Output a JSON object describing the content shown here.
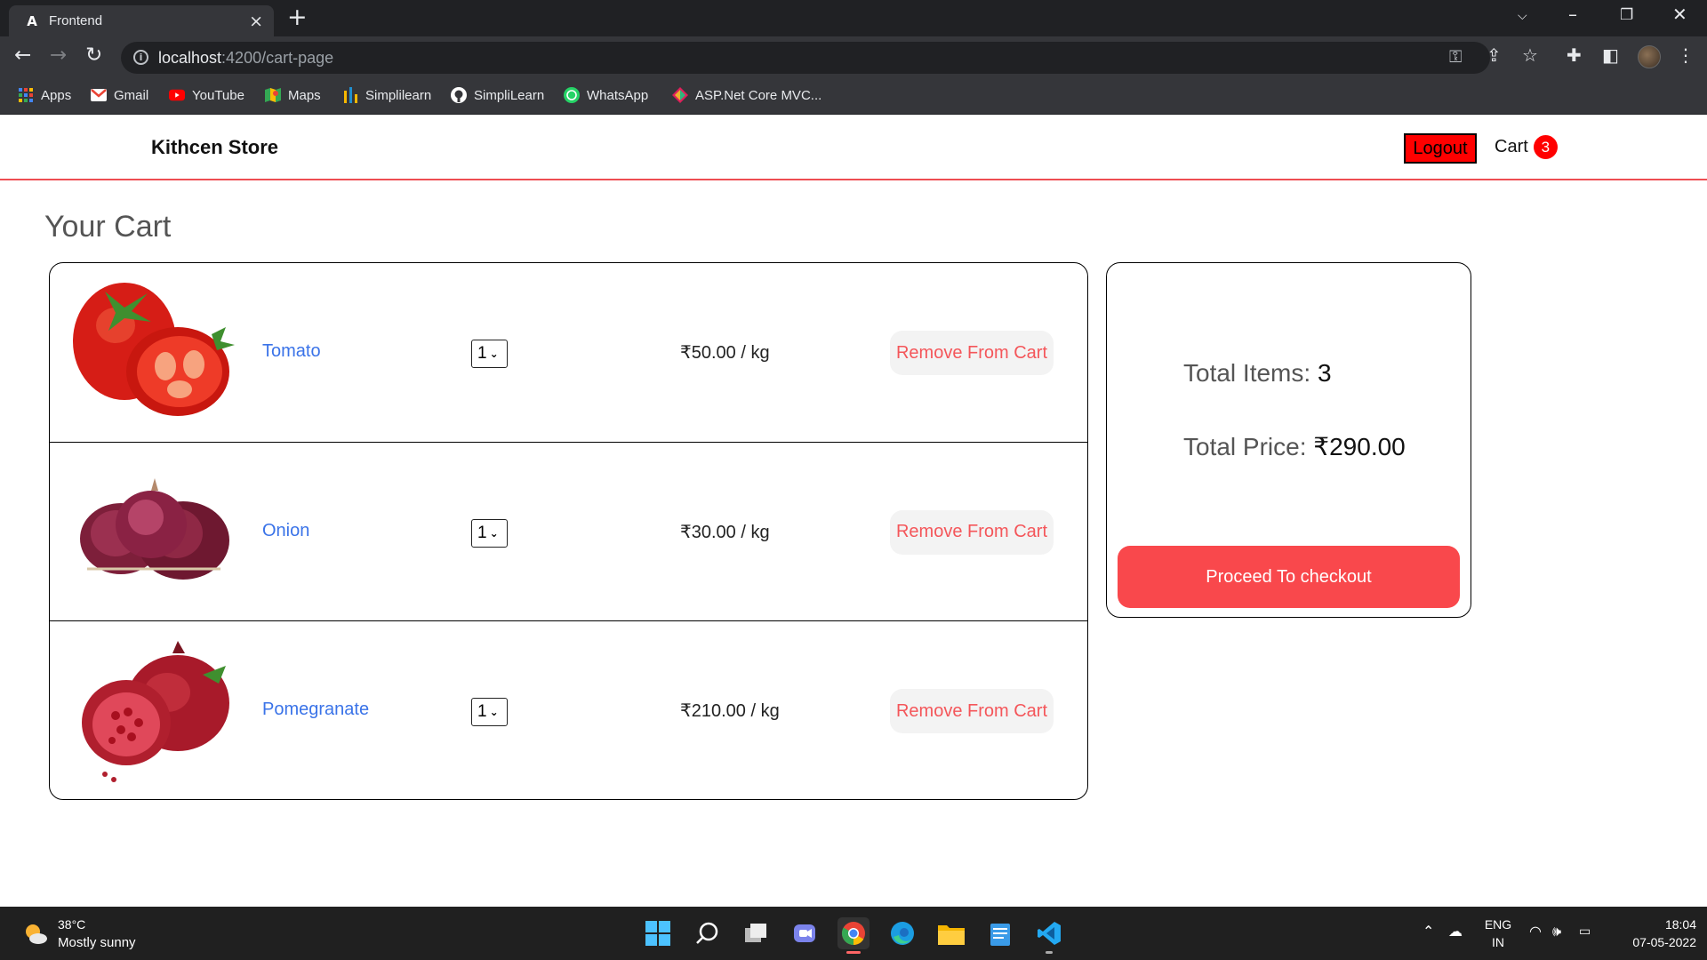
{
  "browser": {
    "tab_title": "Frontend",
    "url_host": "localhost",
    "url_path": ":4200/cart-page",
    "bookmarks": [
      {
        "label": "Apps",
        "icon": "apps-grid-icon"
      },
      {
        "label": "Gmail",
        "icon": "gmail-icon"
      },
      {
        "label": "YouTube",
        "icon": "youtube-icon"
      },
      {
        "label": "Maps",
        "icon": "maps-icon"
      },
      {
        "label": "Simplilearn",
        "icon": "simplilearn-icon"
      },
      {
        "label": "SimpliLearn",
        "icon": "github-icon"
      },
      {
        "label": "WhatsApp",
        "icon": "whatsapp-icon"
      },
      {
        "label": "ASP.Net Core MVC...",
        "icon": "aspnet-icon"
      }
    ]
  },
  "navbar": {
    "brand": "Kithcen Store",
    "logout_label": "Logout",
    "cart_label": "Cart",
    "cart_count": "3",
    "accent_color": "#ee4e52"
  },
  "page": {
    "title": "Your Cart"
  },
  "cart": {
    "items": [
      {
        "name": "Tomato",
        "quantity": "1",
        "price": "₹50.00 / kg",
        "remove_label": "Remove From Cart",
        "image": "tomato-image"
      },
      {
        "name": "Onion",
        "quantity": "1",
        "price": "₹30.00 / kg",
        "remove_label": "Remove From Cart",
        "image": "onion-image"
      },
      {
        "name": "Pomegranate",
        "quantity": "1",
        "price": "₹210.00 / kg",
        "remove_label": "Remove From Cart",
        "image": "pomegranate-image"
      }
    ]
  },
  "summary": {
    "total_items_label": "Total Items:",
    "total_items_value": "3",
    "total_price_label": "Total Price:",
    "total_price_value": "₹290.00",
    "checkout_label": "Proceed To checkout",
    "checkout_color": "#f9484c"
  },
  "taskbar": {
    "weather_temp": "38°C",
    "weather_desc": "Mostly sunny",
    "lang_top": "ENG",
    "lang_bottom": "IN",
    "time": "18:04",
    "date": "07-05-2022"
  }
}
